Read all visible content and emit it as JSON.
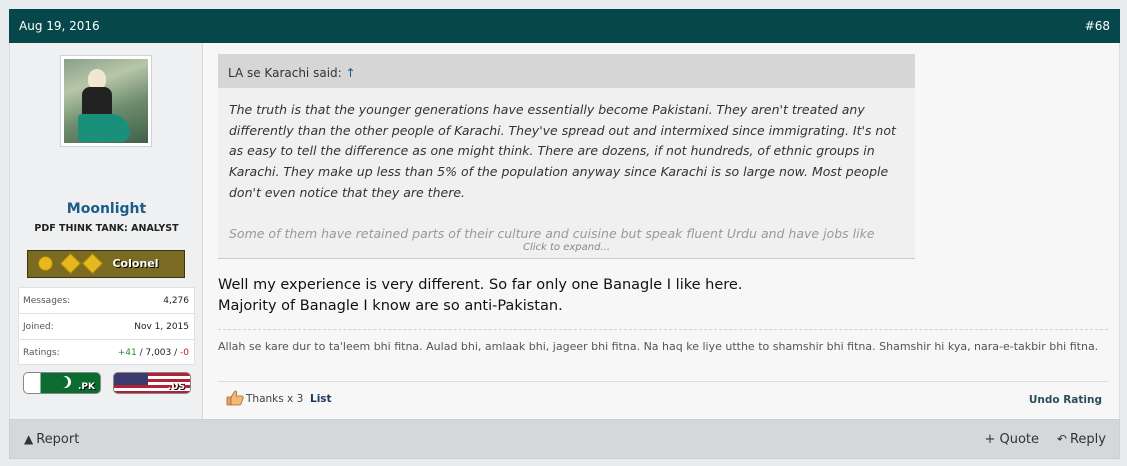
{
  "post_header": {
    "date": "Aug 19, 2016",
    "post_number": "#68"
  },
  "user": {
    "name": "Moonlight",
    "title": "PDF THINK TANK: ANALYST",
    "rank": "Colonel",
    "stats": [
      {
        "label": "Messages:",
        "value": "4,276"
      },
      {
        "label": "Joined:",
        "value": "Nov 1, 2015"
      }
    ],
    "ratings": {
      "label": "Ratings:",
      "positive": "+41",
      "neutral": " / 7,003 / ",
      "negative": "-0"
    },
    "flags": [
      {
        "code": ".PK",
        "icon": "pakistan-flag-icon"
      },
      {
        "code": ".US",
        "icon": "usa-flag-icon"
      }
    ]
  },
  "quote": {
    "header_text": "LA se Karachi said: ",
    "header_arrow": "↑",
    "paragraph_1": "The truth is that the younger generations have essentially become Pakistani. They aren't treated any differently than the other people of Karachi. They've spread out and intermixed since immigrating. It's not as easy to tell the difference as one might think. There are dozens, if not hundreds, of ethnic groups in Karachi. They make up less than 5% of the population anyway since Karachi is so large now. Most people don't even notice that they are there.",
    "paragraph_2": "Some of them have retained parts of their culture and cuisine but speak fluent Urdu and have jobs like",
    "expand_label": "Click to expand..."
  },
  "message": {
    "line_1": "Well my experience is very different. So far only one Banagle I like here.",
    "line_2": "Majority of Banagle I know are so anti-Pakistan."
  },
  "signature": "Allah se kare dur to ta'leem bhi fitna. Aulad bhi, amlaak bhi, jageer bhi fitna. Na haq ke liye utthe to shamshir bhi fitna. Shamshir hi kya, nara-e-takbir bhi fitna.",
  "ratings_bar": {
    "thanks_text": "Thanks x 3",
    "list_label": "List",
    "undo_label": "Undo Rating",
    "icon": "thumbs-up-icon"
  },
  "footer": {
    "report_label": "Report",
    "quote_label": "+ Quote",
    "reply_label": "Reply"
  },
  "colors": {
    "header_bg": "#05474a",
    "username": "#1d5b8a",
    "rank_bg": "#7a6a22"
  }
}
